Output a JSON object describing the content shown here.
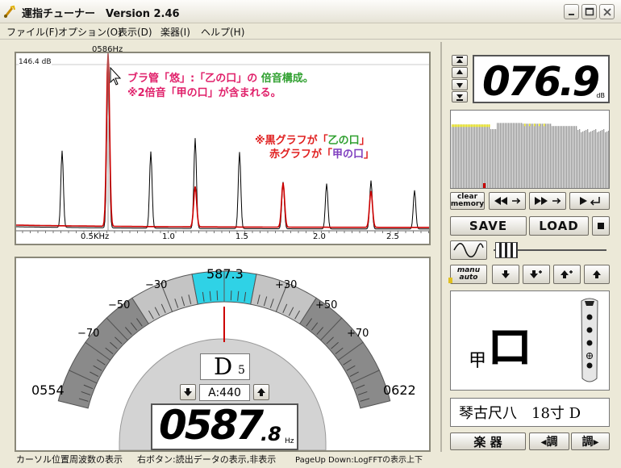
{
  "window": {
    "title": "運指チューナー　Version 2.46"
  },
  "menu": [
    {
      "label": "ファイル(F)"
    },
    {
      "label": "オプション(O)"
    },
    {
      "label": "表示(D)"
    },
    {
      "label": "楽器(I)"
    },
    {
      "label": "ヘルプ(H)"
    }
  ],
  "spectrum": {
    "cursor_freq_label": "0586Hz",
    "db_top_label": "146.4 dB",
    "x_ticks": [
      "0.5KHz",
      "1.0",
      "1.5",
      "2.0",
      "2.5"
    ],
    "annotation_line1_a": "ブラ管「悠」:「乙の口」の",
    "annotation_line1_b": "倍音構成。",
    "annotation_line2": "※2倍音「甲の口」が含まれる。",
    "legend_line1_a": "※黒グラフが「",
    "legend_line1_b": "乙の口",
    "legend_line1_c": "」",
    "legend_line2_a": "赤グラフが「",
    "legend_line2_b": "甲の口",
    "legend_line2_c": "」",
    "colors": {
      "black_series": "#000000",
      "red_series": "#cc0000",
      "accent_pink": "#e0206a",
      "accent_green": "#30a030",
      "accent_purple": "#8040c0"
    }
  },
  "tuner": {
    "center_freq": "587.3",
    "cent_labels": [
      "−70",
      "−50",
      "−30",
      "+30",
      "+50",
      "+70"
    ],
    "left_freq": "0554",
    "right_freq": "0622",
    "note_name": "D",
    "note_octave": "5",
    "a_ref": "A:440",
    "freq_main": "0587",
    "freq_decimal": ".8",
    "freq_unit": "Hz",
    "needle_cents": 0,
    "colors": {
      "highlight": "#2fd2e6",
      "needle": "#cc0000",
      "arc_dark": "#8a8a8a",
      "arc_light": "#c4c4c4"
    }
  },
  "status": {
    "part1": "カーソル位置周波数の表示",
    "part2": "右ボタン:読出データの表示,非表示",
    "part3": "PageUp Down:LogFFTの表示上下"
  },
  "right_panel": {
    "db_value": "076.9",
    "db_unit": "dB",
    "clear_memory_line1": "clear",
    "clear_memory_line2": "memory",
    "save_label": "SAVE",
    "load_label": "LOAD",
    "manu_label": "manu",
    "auto_label": "auto",
    "fingering_char_small": "甲",
    "fingering_char_big": "ロ",
    "instrument_text": "琴古尺八　18寸 D",
    "gakki_label": "楽 器",
    "chou_left_label": "◂調",
    "chou_right_label": "調▸"
  }
}
